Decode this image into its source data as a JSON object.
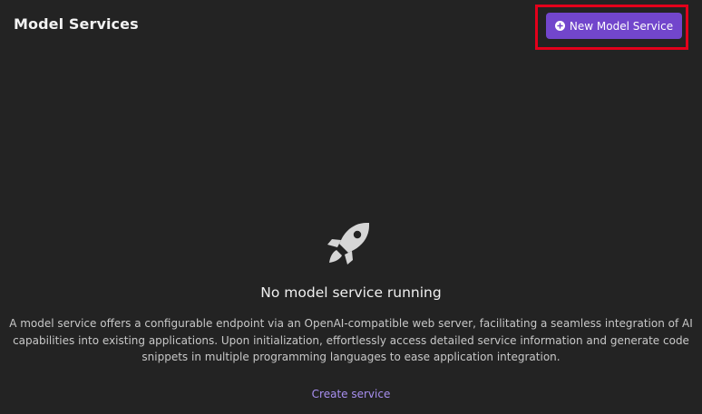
{
  "header": {
    "title": "Model Services",
    "new_button_label": "New Model Service"
  },
  "empty_state": {
    "icon": "rocket-icon",
    "title": "No model service running",
    "description": "A model service offers a configurable endpoint via an OpenAI-compatible web server, facilitating a seamless integration of AI capabilities into existing applications. Upon initialization, effortlessly access detailed service information and generate code snippets in multiple programming languages to ease application integration.",
    "link_label": "Create service"
  },
  "colors": {
    "background": "#232323",
    "accent": "#7246cc",
    "link": "#a88ff0",
    "highlight": "#e3001b"
  }
}
